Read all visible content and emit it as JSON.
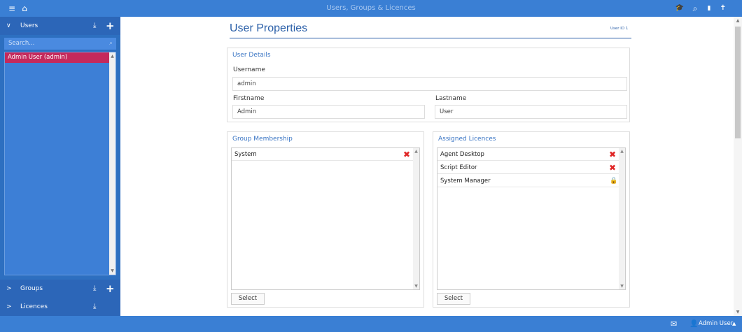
{
  "app": {
    "title": "Users, Groups & Licences"
  },
  "topbar": {
    "menu_icon": "≡",
    "home_icon": "⌂",
    "grad_icon": "🎓",
    "search_icon": "⌕",
    "bookmark_icon": "▮",
    "pin_icon": "✝"
  },
  "sidebar": {
    "users": {
      "label": "Users",
      "chevron": "∨",
      "download_icon": "⤓",
      "add_icon": "+"
    },
    "search_placeholder": "Search...",
    "items": [
      {
        "label": "Admin User (admin)"
      }
    ],
    "groups": {
      "label": "Groups",
      "chevron": ">",
      "download_icon": "⤓",
      "add_icon": "+"
    },
    "licences": {
      "label": "Licences",
      "chevron": ">",
      "download_icon": "⤓"
    }
  },
  "main": {
    "page_title": "User Properties",
    "user_id": "User ID 1",
    "user_details": {
      "title": "User Details",
      "username_label": "Username",
      "username_value": "admin",
      "firstname_label": "Firstname",
      "firstname_value": "Admin",
      "lastname_label": "Lastname",
      "lastname_value": "User"
    },
    "group_membership": {
      "title": "Group Membership",
      "rows": [
        {
          "label": "System",
          "action": "remove"
        }
      ],
      "select_label": "Select"
    },
    "assigned_licences": {
      "title": "Assigned Licences",
      "rows": [
        {
          "label": "Agent Desktop",
          "action": "remove"
        },
        {
          "label": "Script Editor",
          "action": "remove"
        },
        {
          "label": "System Manager",
          "action": "locked"
        }
      ],
      "select_label": "Select"
    }
  },
  "bottombar": {
    "mail_icon": "✉",
    "user_icon": "👤",
    "user_name": "Admin User",
    "caret": "▲"
  },
  "colors": {
    "accent": "#3a7fd4",
    "sidebar": "#2d6fc0",
    "active_item": "#c4295c",
    "remove": "#e02727",
    "title": "#2a5fa8"
  }
}
